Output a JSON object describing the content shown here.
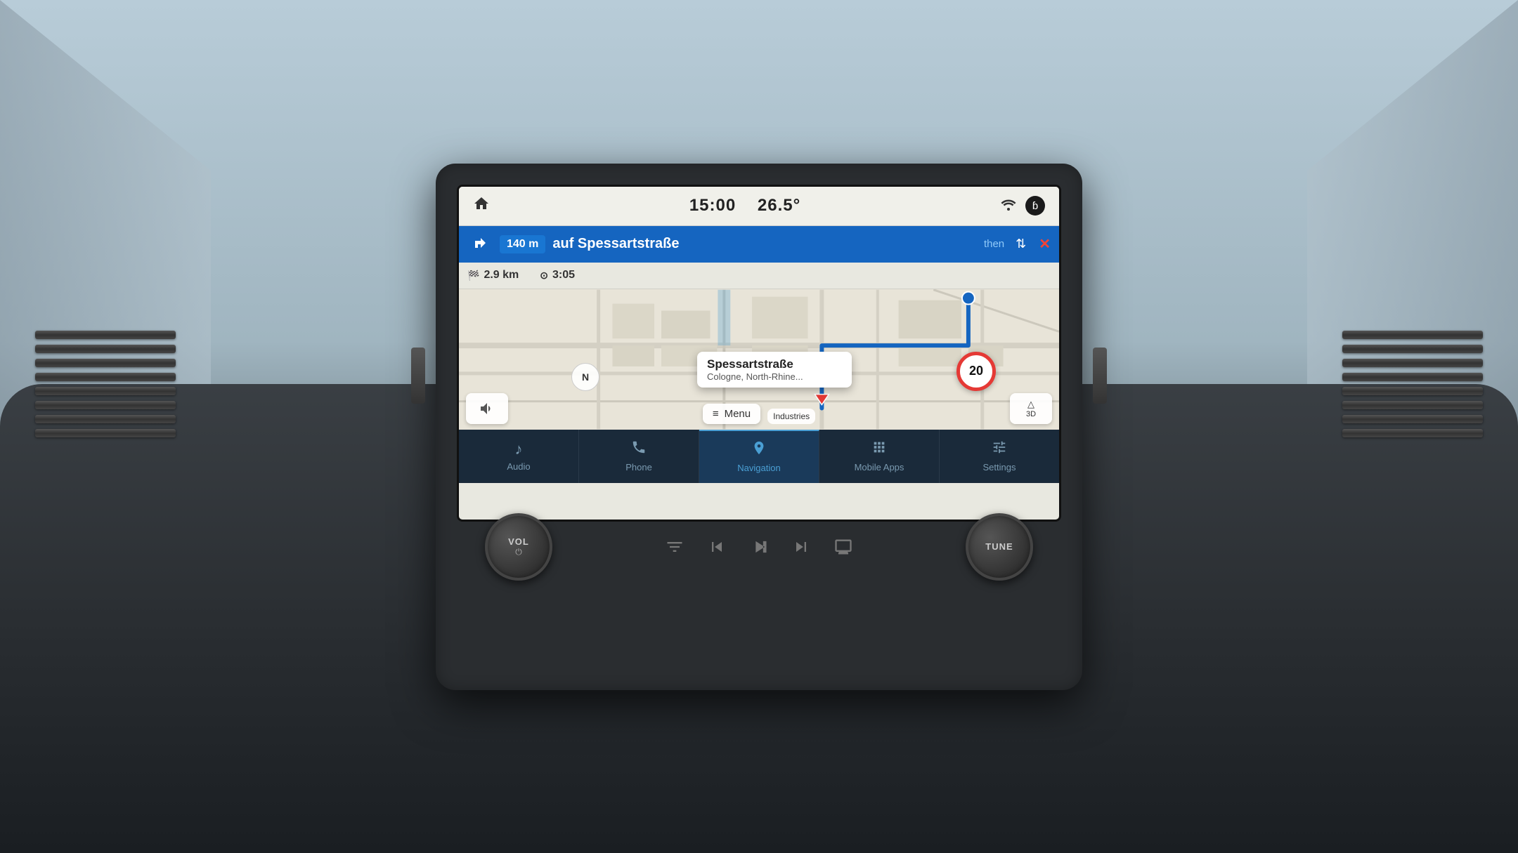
{
  "car": {
    "background_color": "#b8ccd8"
  },
  "status_bar": {
    "time": "15:00",
    "temperature": "26.5°",
    "home_icon": "⌂",
    "wifi_icon": "wifi",
    "bluetooth_icon": "B"
  },
  "navigation": {
    "turn_distance": "140 m",
    "street_name": "auf Spessartstraße",
    "then_label": "then",
    "close_icon": "✕",
    "total_distance": "2.9 km",
    "eta_time": "3:05",
    "current_street": "Spessartstraße",
    "current_city": "Cologne, North-Rhine...",
    "speed_limit": "20",
    "compass_direction": "N",
    "menu_label": "Menu",
    "industries_label": "Industries",
    "view_3d_label": "3D",
    "view_3d_icon": "△"
  },
  "nav_tabs": [
    {
      "id": "audio",
      "label": "Audio",
      "icon": "♪",
      "active": false
    },
    {
      "id": "phone",
      "label": "Phone",
      "icon": "✆",
      "active": false
    },
    {
      "id": "navigation",
      "label": "Navigation",
      "icon": "⊙",
      "active": true
    },
    {
      "id": "mobile_apps",
      "label": "Mobile Apps",
      "icon": "⊞",
      "active": false
    },
    {
      "id": "settings",
      "label": "Settings",
      "icon": "⚙",
      "active": false
    }
  ],
  "physical_controls": {
    "vol_label": "VOL",
    "tune_label": "TUNE",
    "eq_icon": "⚌",
    "prev_icon": "⏮",
    "play_pause_icon": "⏯",
    "next_icon": "⏭",
    "screen_icon": "▭"
  }
}
